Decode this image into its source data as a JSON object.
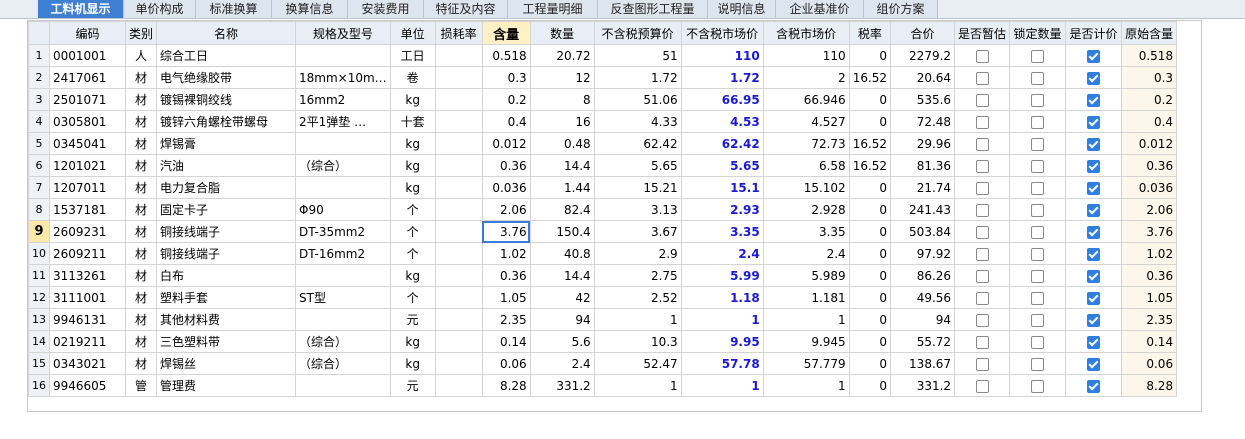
{
  "tabs": [
    "工料机显示",
    "单价构成",
    "标准换算",
    "换算信息",
    "安装费用",
    "特征及内容",
    "工程量明细",
    "反查图形工程量",
    "说明信息",
    "企业基准价",
    "组价方案"
  ],
  "active_tab": 0,
  "columns": [
    "",
    "编码",
    "类别",
    "名称",
    "规格及型号",
    "单位",
    "损耗率",
    "含量",
    "数量",
    "不含税预算价",
    "不含税市场价",
    "含税市场价",
    "税率",
    "合价",
    "是否暂估",
    "锁定数量",
    "是否计价",
    "原始含量"
  ],
  "highlight_column": 7,
  "current_row": 8,
  "selected_cell": {
    "row": 8,
    "col": 7
  },
  "rows": [
    {
      "no": "1",
      "code": "0001001",
      "cat": "人",
      "name": "综合工日",
      "spec": "",
      "unit": "工日",
      "loss": "",
      "qty": "0.518",
      "amount": "20.72",
      "pre": "51",
      "mkt": "110",
      "mkt_tax": "110",
      "rate": "0",
      "total": "2279.2",
      "est": false,
      "lock": false,
      "calc": true,
      "orig": "0.518"
    },
    {
      "no": "2",
      "code": "2417061",
      "cat": "材",
      "name": "电气绝缘胶带",
      "spec": "18mm×10m…",
      "unit": "卷",
      "loss": "",
      "qty": "0.3",
      "amount": "12",
      "pre": "1.72",
      "mkt": "1.72",
      "mkt_tax": "2",
      "rate": "16.52",
      "total": "20.64",
      "est": false,
      "lock": false,
      "calc": true,
      "orig": "0.3"
    },
    {
      "no": "3",
      "code": "2501071",
      "cat": "材",
      "name": "镀锡裸铜绞线",
      "spec": "16mm2",
      "unit": "kg",
      "loss": "",
      "qty": "0.2",
      "amount": "8",
      "pre": "51.06",
      "mkt": "66.95",
      "mkt_tax": "66.946",
      "rate": "0",
      "total": "535.6",
      "est": false,
      "lock": false,
      "calc": true,
      "orig": "0.2"
    },
    {
      "no": "4",
      "code": "0305801",
      "cat": "材",
      "name": "镀锌六角螺栓带螺母",
      "spec": "2平1弹垫 …",
      "unit": "十套",
      "loss": "",
      "qty": "0.4",
      "amount": "16",
      "pre": "4.33",
      "mkt": "4.53",
      "mkt_tax": "4.527",
      "rate": "0",
      "total": "72.48",
      "est": false,
      "lock": false,
      "calc": true,
      "orig": "0.4"
    },
    {
      "no": "5",
      "code": "0345041",
      "cat": "材",
      "name": "焊锡膏",
      "spec": "",
      "unit": "kg",
      "loss": "",
      "qty": "0.012",
      "amount": "0.48",
      "pre": "62.42",
      "mkt": "62.42",
      "mkt_tax": "72.73",
      "rate": "16.52",
      "total": "29.96",
      "est": false,
      "lock": false,
      "calc": true,
      "orig": "0.012"
    },
    {
      "no": "6",
      "code": "1201021",
      "cat": "材",
      "name": "汽油",
      "spec": "（综合）",
      "unit": "kg",
      "loss": "",
      "qty": "0.36",
      "amount": "14.4",
      "pre": "5.65",
      "mkt": "5.65",
      "mkt_tax": "6.58",
      "rate": "16.52",
      "total": "81.36",
      "est": false,
      "lock": false,
      "calc": true,
      "orig": "0.36"
    },
    {
      "no": "7",
      "code": "1207011",
      "cat": "材",
      "name": "电力复合脂",
      "spec": "",
      "unit": "kg",
      "loss": "",
      "qty": "0.036",
      "amount": "1.44",
      "pre": "15.21",
      "mkt": "15.1",
      "mkt_tax": "15.102",
      "rate": "0",
      "total": "21.74",
      "est": false,
      "lock": false,
      "calc": true,
      "orig": "0.036"
    },
    {
      "no": "8",
      "code": "1537181",
      "cat": "材",
      "name": "固定卡子",
      "spec": "Φ90",
      "unit": "个",
      "loss": "",
      "qty": "2.06",
      "amount": "82.4",
      "pre": "3.13",
      "mkt": "2.93",
      "mkt_tax": "2.928",
      "rate": "0",
      "total": "241.43",
      "est": false,
      "lock": false,
      "calc": true,
      "orig": "2.06"
    },
    {
      "no": "9",
      "code": "2609231",
      "cat": "材",
      "name": "铜接线端子",
      "spec": "DT-35mm2",
      "unit": "个",
      "loss": "",
      "qty": "3.76",
      "amount": "150.4",
      "pre": "3.67",
      "mkt": "3.35",
      "mkt_tax": "3.35",
      "rate": "0",
      "total": "503.84",
      "est": false,
      "lock": false,
      "calc": true,
      "orig": "3.76"
    },
    {
      "no": "10",
      "code": "2609211",
      "cat": "材",
      "name": "铜接线端子",
      "spec": "DT-16mm2",
      "unit": "个",
      "loss": "",
      "qty": "1.02",
      "amount": "40.8",
      "pre": "2.9",
      "mkt": "2.4",
      "mkt_tax": "2.4",
      "rate": "0",
      "total": "97.92",
      "est": false,
      "lock": false,
      "calc": true,
      "orig": "1.02"
    },
    {
      "no": "11",
      "code": "3113261",
      "cat": "材",
      "name": "白布",
      "spec": "",
      "unit": "kg",
      "loss": "",
      "qty": "0.36",
      "amount": "14.4",
      "pre": "2.75",
      "mkt": "5.99",
      "mkt_tax": "5.989",
      "rate": "0",
      "total": "86.26",
      "est": false,
      "lock": false,
      "calc": true,
      "orig": "0.36"
    },
    {
      "no": "12",
      "code": "3111001",
      "cat": "材",
      "name": "塑料手套",
      "spec": "ST型",
      "unit": "个",
      "loss": "",
      "qty": "1.05",
      "amount": "42",
      "pre": "2.52",
      "mkt": "1.18",
      "mkt_tax": "1.181",
      "rate": "0",
      "total": "49.56",
      "est": false,
      "lock": false,
      "calc": true,
      "orig": "1.05"
    },
    {
      "no": "13",
      "code": "9946131",
      "cat": "材",
      "name": "其他材料费",
      "spec": "",
      "unit": "元",
      "loss": "",
      "qty": "2.35",
      "amount": "94",
      "pre": "1",
      "mkt": "1",
      "mkt_tax": "1",
      "rate": "0",
      "total": "94",
      "est": false,
      "lock": false,
      "calc": true,
      "orig": "2.35"
    },
    {
      "no": "14",
      "code": "0219211",
      "cat": "材",
      "name": "三色塑料带",
      "spec": "（综合）",
      "unit": "kg",
      "loss": "",
      "qty": "0.14",
      "amount": "5.6",
      "pre": "10.3",
      "mkt": "9.95",
      "mkt_tax": "9.945",
      "rate": "0",
      "total": "55.72",
      "est": false,
      "lock": false,
      "calc": true,
      "orig": "0.14"
    },
    {
      "no": "15",
      "code": "0343021",
      "cat": "材",
      "name": "焊锡丝",
      "spec": "（综合）",
      "unit": "kg",
      "loss": "",
      "qty": "0.06",
      "amount": "2.4",
      "pre": "52.47",
      "mkt": "57.78",
      "mkt_tax": "57.779",
      "rate": "0",
      "total": "138.67",
      "est": false,
      "lock": false,
      "calc": true,
      "orig": "0.06"
    },
    {
      "no": "16",
      "code": "9946605",
      "cat": "管",
      "name": "管理费",
      "spec": "",
      "unit": "元",
      "loss": "",
      "qty": "8.28",
      "amount": "331.2",
      "pre": "1",
      "mkt": "1",
      "mkt_tax": "1",
      "rate": "0",
      "total": "331.2",
      "est": false,
      "lock": false,
      "calc": true,
      "orig": "8.28"
    }
  ],
  "colors": {
    "tab_active": "#3e7fd1",
    "market_price": "#1a1ad6",
    "checkbox_on": "#2f7fe0",
    "selection": "#3a7bd5"
  }
}
